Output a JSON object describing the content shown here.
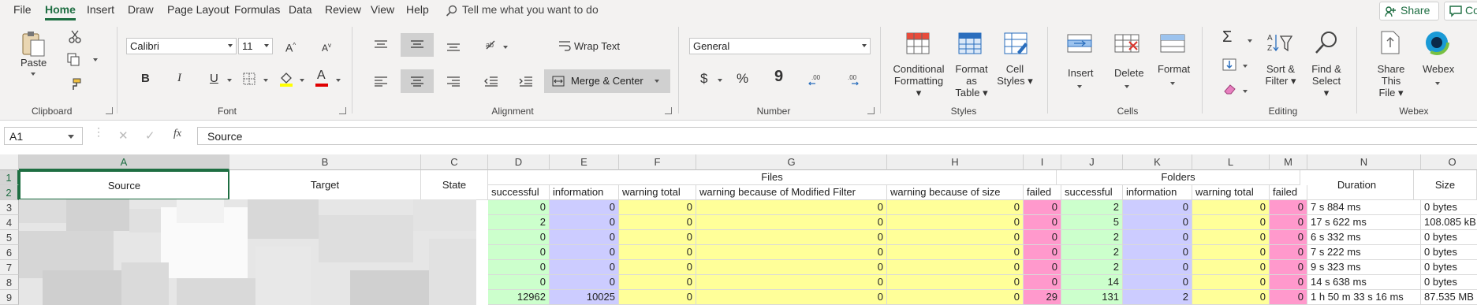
{
  "menu": {
    "tabs": [
      "File",
      "Home",
      "Insert",
      "Draw",
      "Page Layout",
      "Formulas",
      "Data",
      "Review",
      "View",
      "Help"
    ],
    "active": "Home",
    "tell_me": "Tell me what you want to do",
    "share": "Share",
    "comments": "Comm"
  },
  "ribbon": {
    "clipboard": {
      "paste": "Paste",
      "label": "Clipboard"
    },
    "font": {
      "name": "Calibri",
      "size": "11",
      "label": "Font",
      "bold": "B",
      "italic": "I",
      "underline": "U",
      "font_color": "A"
    },
    "alignment": {
      "wrap": "Wrap Text",
      "merge": "Merge & Center",
      "label": "Alignment"
    },
    "number": {
      "format": "General",
      "currency": "$",
      "percent": "%",
      "comma": "9",
      "label": "Number"
    },
    "styles": {
      "conditional": [
        "Conditional",
        "Formatting"
      ],
      "format_table": [
        "Format as",
        "Table"
      ],
      "cell_styles": [
        "Cell",
        "Styles"
      ],
      "label": "Styles"
    },
    "cells": {
      "insert": "Insert",
      "delete": "Delete",
      "format": "Format",
      "label": "Cells"
    },
    "editing": {
      "sort": [
        "Sort &",
        "Filter"
      ],
      "find": [
        "Find &",
        "Select"
      ],
      "label": "Editing",
      "sum_icon": "Σ"
    },
    "webex": {
      "share": [
        "Share This",
        "File"
      ],
      "webex": "Webex",
      "label": "Webex"
    }
  },
  "formula_bar": {
    "name_box": "A1",
    "fx": "fx",
    "value": "Source"
  },
  "sheet": {
    "columns": [
      "A",
      "B",
      "C",
      "D",
      "E",
      "F",
      "G",
      "H",
      "I",
      "J",
      "K",
      "L",
      "M",
      "N",
      "O"
    ],
    "active_column": "A",
    "rows": [
      "1",
      "2",
      "3",
      "4",
      "5",
      "6",
      "7",
      "8",
      "9"
    ],
    "header_row1": {
      "source": "Source",
      "target": "Target",
      "state": "State",
      "files": "Files",
      "folders": "Folders",
      "duration": "Duration",
      "size": "Size"
    },
    "header_row2": [
      "successful",
      "information",
      "warning total",
      "warning because of Modified Filter",
      "warning because of size",
      "failed",
      "successful",
      "information",
      "warning total",
      "failed"
    ],
    "data": [
      {
        "d": "0",
        "e": "0",
        "f": "0",
        "g": "0",
        "h": "0",
        "i": "0",
        "j": "2",
        "k": "0",
        "l": "0",
        "m": "0",
        "n": "7 s 884 ms",
        "o": "0 bytes"
      },
      {
        "d": "2",
        "e": "0",
        "f": "0",
        "g": "0",
        "h": "0",
        "i": "0",
        "j": "5",
        "k": "0",
        "l": "0",
        "m": "0",
        "n": "17 s 622 ms",
        "o": "108.085 kB"
      },
      {
        "d": "0",
        "e": "0",
        "f": "0",
        "g": "0",
        "h": "0",
        "i": "0",
        "j": "2",
        "k": "0",
        "l": "0",
        "m": "0",
        "n": "6 s 332 ms",
        "o": "0 bytes"
      },
      {
        "d": "0",
        "e": "0",
        "f": "0",
        "g": "0",
        "h": "0",
        "i": "0",
        "j": "2",
        "k": "0",
        "l": "0",
        "m": "0",
        "n": "7 s 222 ms",
        "o": "0 bytes"
      },
      {
        "d": "0",
        "e": "0",
        "f": "0",
        "g": "0",
        "h": "0",
        "i": "0",
        "j": "2",
        "k": "0",
        "l": "0",
        "m": "0",
        "n": "9 s 323 ms",
        "o": "0 bytes"
      },
      {
        "d": "0",
        "e": "0",
        "f": "0",
        "g": "0",
        "h": "0",
        "i": "0",
        "j": "14",
        "k": "0",
        "l": "0",
        "m": "0",
        "n": "14 s 638 ms",
        "o": "0 bytes"
      },
      {
        "d": "12962",
        "e": "10025",
        "f": "0",
        "g": "0",
        "h": "0",
        "i": "29",
        "j": "131",
        "k": "2",
        "l": "0",
        "m": "0",
        "n": "1 h 50 m 33 s 16 ms",
        "o": "87.535 MB"
      }
    ]
  },
  "colors": {
    "accent": "#1e6e42",
    "green": "#ccffcc",
    "blue": "#ccccff",
    "yellow": "#ffff99",
    "pink": "#ff99cc"
  }
}
